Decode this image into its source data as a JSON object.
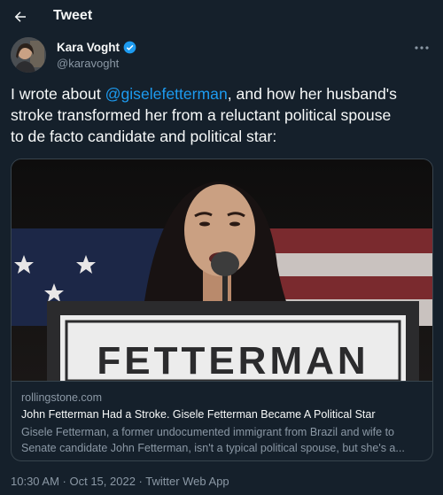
{
  "header": {
    "title": "Tweet"
  },
  "author": {
    "name": "Kara Voght",
    "handle": "@karavoght"
  },
  "tweet": {
    "text_line1_pre": "I wrote about ",
    "mention": "@giselefetterman",
    "text_line1_post": ", and how her husband's",
    "text_line2": "stroke transformed her from a reluctant political spouse",
    "text_line3": "to de facto candidate and political star:"
  },
  "card": {
    "sign_text": "FETTERMAN",
    "domain": "rollingstone.com",
    "title": "John Fetterman Had a Stroke. Gisele Fetterman Became A Political Star",
    "description_line1": "Gisele Fetterman, a former undocumented immigrant from Brazil and wife to",
    "description_line2": "Senate candidate John Fetterman, isn't a typical political spouse, but she's a..."
  },
  "meta": {
    "timestamp": "10:30 AM · Oct 15, 2022 · Twitter Web App"
  },
  "icons": {
    "back": "back-arrow-icon",
    "verified": "verified-badge-icon",
    "more": "more-horizontal-icon"
  },
  "colors": {
    "background": "#15202b",
    "accent": "#1d9bf0",
    "muted": "#8b98a5",
    "border": "#38444d"
  }
}
